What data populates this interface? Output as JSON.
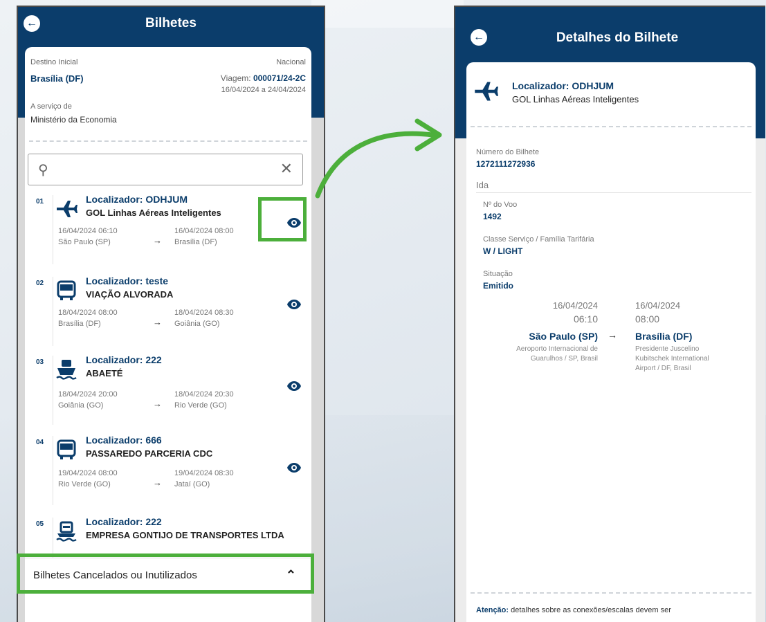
{
  "left": {
    "title": "Bilhetes",
    "header": {
      "destino_label": "Destino Inicial",
      "destino_value": "Brasília (DF)",
      "tipo": "Nacional",
      "viagem_label": "Viagem:",
      "viagem_value": "000071/24-2C",
      "periodo": "16/04/2024 a 24/04/2024",
      "servico_label": "A serviço de",
      "servico_value": "Ministério da Economia"
    },
    "search": {
      "placeholder": ""
    },
    "items": [
      {
        "num": "01",
        "icon": "airplane-icon",
        "localizador": "Localizador: ODHJUM",
        "company": "GOL Linhas Aéreas Inteligentes",
        "dep_dt": "16/04/2024 06:10",
        "dep_city": "São Paulo (SP)",
        "arr_dt": "16/04/2024 08:00",
        "arr_city": "Brasília (DF)"
      },
      {
        "num": "02",
        "icon": "bus-icon",
        "localizador": "Localizador: teste",
        "company": "VIAÇÃO ALVORADA",
        "dep_dt": "18/04/2024 08:00",
        "dep_city": "Brasília (DF)",
        "arr_dt": "18/04/2024 08:30",
        "arr_city": "Goiânia (GO)"
      },
      {
        "num": "03",
        "icon": "ship-icon",
        "localizador": "Localizador: 222",
        "company": "ABAETÉ",
        "dep_dt": "18/04/2024 20:00",
        "dep_city": "Goiânia (GO)",
        "arr_dt": "18/04/2024 20:30",
        "arr_city": "Rio Verde (GO)"
      },
      {
        "num": "04",
        "icon": "bus-icon",
        "localizador": "Localizador: 666",
        "company": "PASSAREDO PARCERIA CDC",
        "dep_dt": "19/04/2024 08:00",
        "dep_city": "Rio Verde (GO)",
        "arr_dt": "19/04/2024 08:30",
        "arr_city": "Jataí (GO)"
      },
      {
        "num": "05",
        "icon": "ferry-icon",
        "localizador": "Localizador: 222",
        "company": "EMPRESA GONTIJO DE TRANSPORTES LTDA",
        "dep_dt": "",
        "dep_city": "",
        "arr_dt": "",
        "arr_city": ""
      }
    ],
    "cancelled_label": "Bilhetes Cancelados ou Inutilizados"
  },
  "right": {
    "title": "Detalhes do Bilhete",
    "localizador": "Localizador: ODHJUM",
    "company": "GOL Linhas Aéreas Inteligentes",
    "numero_label": "Número do Bilhete",
    "numero_value": "1272111272936",
    "ida_label": "Ida",
    "voo_label": "Nº do Voo",
    "voo_value": "1492",
    "classe_label": "Classe Serviço / Família Tarifária",
    "classe_value": "W / LIGHT",
    "situacao_label": "Situação",
    "situacao_value": "Emitido",
    "dep_date": "16/04/2024",
    "dep_time": "06:10",
    "dep_city": "São Paulo (SP)",
    "dep_airport_1": "Aeroporto Internacional de",
    "dep_airport_2": "Guarulhos / SP, Brasil",
    "arr_date": "16/04/2024",
    "arr_time": "08:00",
    "arr_city": "Brasília (DF)",
    "arr_airport_1": "Presidente Juscelino",
    "arr_airport_2": "Kubitschek International",
    "arr_airport_3": "Airport / DF, Brasil",
    "atencao_label": "Atenção:",
    "atencao_text": "detalhes sobre as conexões/escalas devem ser"
  },
  "colors": {
    "primary": "#0b3d6b",
    "highlight": "#4caf3b"
  }
}
